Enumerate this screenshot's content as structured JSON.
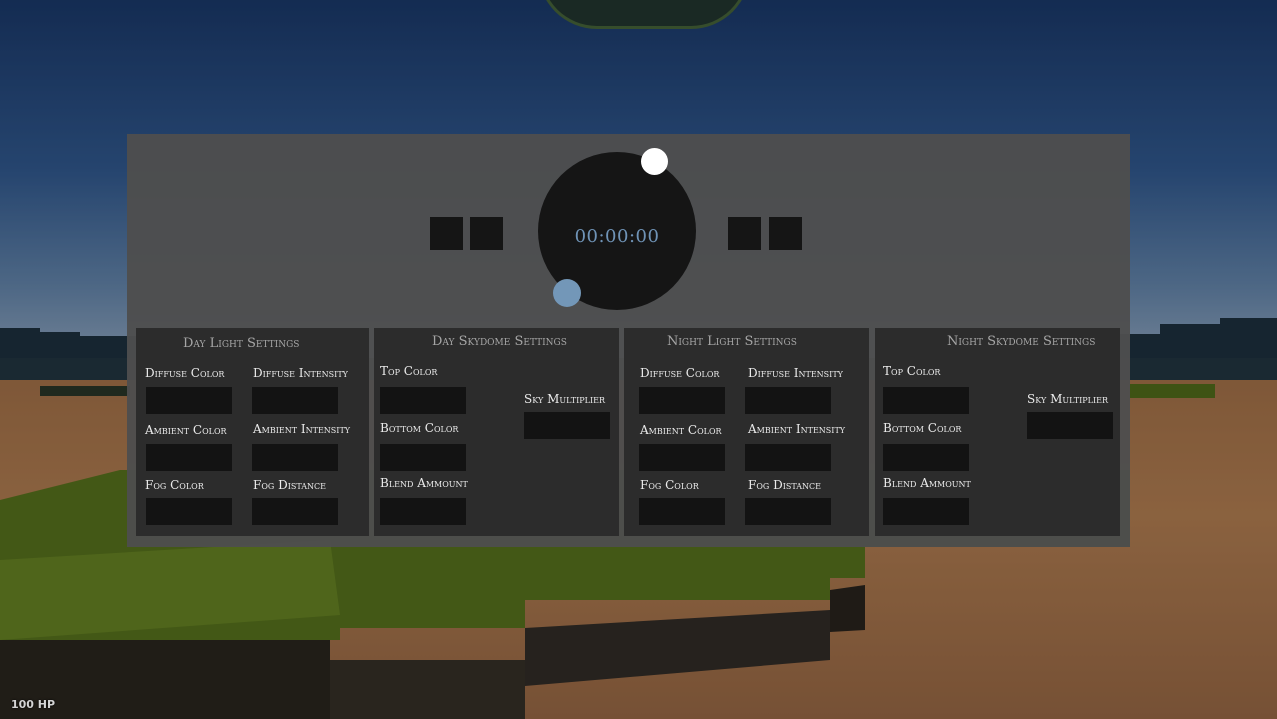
{
  "clock": {
    "time": "00:00:00"
  },
  "day_light": {
    "title": "Day Light Settings",
    "diffuse_color_label": "Diffuse Color",
    "diffuse_intensity_label": "Diffuse Intensity",
    "ambient_color_label": "Ambient Color",
    "ambient_intensity_label": "Ambient Intensity",
    "fog_color_label": "Fog Color",
    "fog_distance_label": "Fog Distance",
    "values": {
      "diffuse_color": "",
      "diffuse_intensity": "",
      "ambient_color": "",
      "ambient_intensity": "",
      "fog_color": "",
      "fog_distance": ""
    }
  },
  "day_skydome": {
    "title": "Day Skydome Settings",
    "top_color_label": "Top Color",
    "bottom_color_label": "Bottom Color",
    "blend_amount_label": "Blend Ammount",
    "sky_multiplier_label": "Sky Multiplier",
    "values": {
      "top_color": "",
      "bottom_color": "",
      "blend_amount": "",
      "sky_multiplier": ""
    }
  },
  "night_light": {
    "title": "Night Light Settings",
    "diffuse_color_label": "Diffuse Color",
    "diffuse_intensity_label": "Diffuse Intensity",
    "ambient_color_label": "Ambient Color",
    "ambient_intensity_label": "Ambient Intensity",
    "fog_color_label": "Fog Color",
    "fog_distance_label": "Fog Distance",
    "values": {
      "diffuse_color": "",
      "diffuse_intensity": "",
      "ambient_color": "",
      "ambient_intensity": "",
      "fog_color": "",
      "fog_distance": ""
    }
  },
  "night_skydome": {
    "title": "Night Skydome Settings",
    "top_color_label": "Top Color",
    "bottom_color_label": "Bottom Color",
    "blend_amount_label": "Blend Ammount",
    "sky_multiplier_label": "Sky Multiplier",
    "values": {
      "top_color": "",
      "bottom_color": "",
      "blend_amount": "",
      "sky_multiplier": ""
    }
  },
  "hud": {
    "health": "100 HP"
  },
  "colors": {
    "panel": "#4e4e4e",
    "section": "#2c2c2c",
    "input": "#131313",
    "clock_text": "#6f93b6",
    "moon_handle": "#7397b8",
    "sun_handle": "#ffffff"
  }
}
